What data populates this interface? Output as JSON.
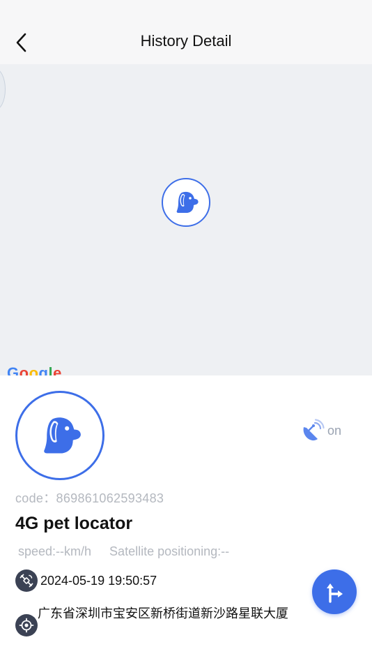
{
  "header": {
    "title": "History Detail"
  },
  "map": {
    "attribution": "Google"
  },
  "device": {
    "code_label": "code：",
    "code_value": "869861062593483",
    "name": "4G pet locator",
    "gps_status": "on",
    "speed": "speed:--km/h",
    "positioning": "Satellite positioning:--",
    "timestamp": "2024-05-19 19:50:57",
    "address": "广东省深圳市宝安区新桥街道新沙路星联大厦"
  },
  "icons": {
    "back": "chevron-left-icon",
    "marker": "dog-icon",
    "gps": "satellite-dish-icon",
    "time": "satellite-icon",
    "address": "location-target-icon",
    "navigate": "directions-icon"
  },
  "colors": {
    "accent": "#3d6ee8",
    "icon_dark": "#3b4254",
    "muted_text": "#b4b8bf",
    "map_bg": "#eef0f3"
  }
}
